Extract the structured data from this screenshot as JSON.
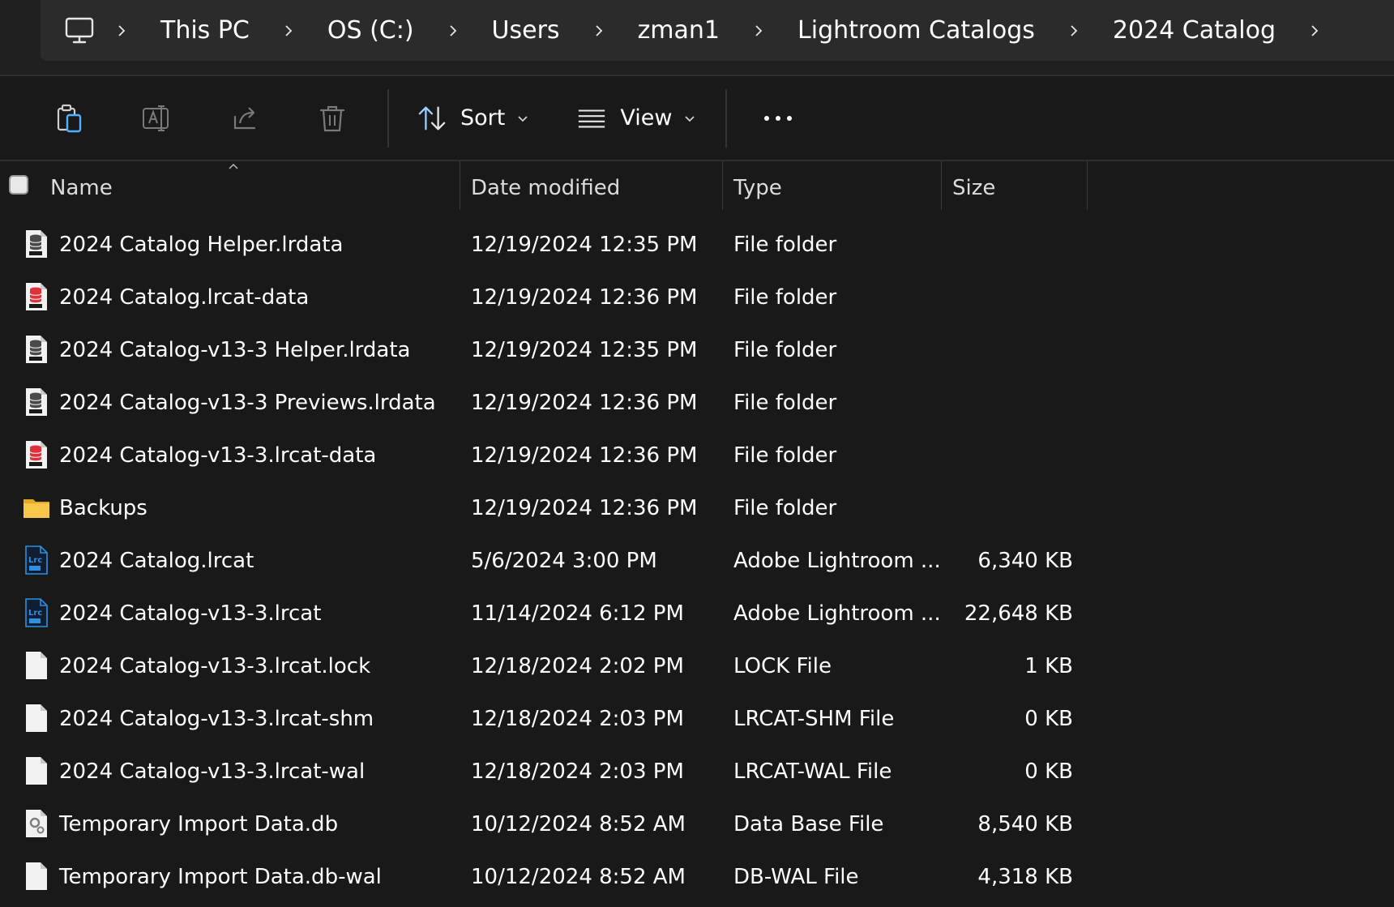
{
  "breadcrumb": {
    "root_icon": "pc-monitor-icon",
    "items": [
      "This PC",
      "OS (C:)",
      "Users",
      "zman1",
      "Lightroom Catalogs",
      "2024 Catalog"
    ]
  },
  "toolbar": {
    "sort_label": "Sort",
    "view_label": "View"
  },
  "columns": {
    "name": "Name",
    "date": "Date modified",
    "type": "Type",
    "size": "Size"
  },
  "files": [
    {
      "name": "2024 Catalog Helper.lrdata",
      "date": "12/19/2024 12:35 PM",
      "type": "File folder",
      "size": "",
      "icon": "lrdata"
    },
    {
      "name": "2024 Catalog.lrcat-data",
      "date": "12/19/2024 12:36 PM",
      "type": "File folder",
      "size": "",
      "icon": "lrcatdata"
    },
    {
      "name": "2024 Catalog-v13-3 Helper.lrdata",
      "date": "12/19/2024 12:35 PM",
      "type": "File folder",
      "size": "",
      "icon": "lrdata"
    },
    {
      "name": "2024 Catalog-v13-3 Previews.lrdata",
      "date": "12/19/2024 12:36 PM",
      "type": "File folder",
      "size": "",
      "icon": "lrdata"
    },
    {
      "name": "2024 Catalog-v13-3.lrcat-data",
      "date": "12/19/2024 12:36 PM",
      "type": "File folder",
      "size": "",
      "icon": "lrcatdata"
    },
    {
      "name": "Backups",
      "date": "12/19/2024 12:36 PM",
      "type": "File folder",
      "size": "",
      "icon": "folder"
    },
    {
      "name": "2024 Catalog.lrcat",
      "date": "5/6/2024 3:00 PM",
      "type": "Adobe Lightroom ...",
      "size": "6,340 KB",
      "icon": "lrcat"
    },
    {
      "name": "2024 Catalog-v13-3.lrcat",
      "date": "11/14/2024 6:12 PM",
      "type": "Adobe Lightroom ...",
      "size": "22,648 KB",
      "icon": "lrcat"
    },
    {
      "name": "2024 Catalog-v13-3.lrcat.lock",
      "date": "12/18/2024 2:02 PM",
      "type": "LOCK File",
      "size": "1 KB",
      "icon": "blank"
    },
    {
      "name": "2024 Catalog-v13-3.lrcat-shm",
      "date": "12/18/2024 2:03 PM",
      "type": "LRCAT-SHM File",
      "size": "0 KB",
      "icon": "blank"
    },
    {
      "name": "2024 Catalog-v13-3.lrcat-wal",
      "date": "12/18/2024 2:03 PM",
      "type": "LRCAT-WAL File",
      "size": "0 KB",
      "icon": "blank"
    },
    {
      "name": "Temporary Import Data.db",
      "date": "10/12/2024 8:52 AM",
      "type": "Data Base File",
      "size": "8,540 KB",
      "icon": "db"
    },
    {
      "name": "Temporary Import Data.db-wal",
      "date": "10/12/2024 8:52 AM",
      "type": "DB-WAL File",
      "size": "4,318 KB",
      "icon": "blank"
    }
  ],
  "colors": {
    "background": "#191919",
    "addressbar": "#2b2b2b",
    "text": "#ffffff",
    "folder": "#f8c74a",
    "lrc_blue": "#2f8fe0",
    "lrcatdata_red": "#e0313b"
  }
}
